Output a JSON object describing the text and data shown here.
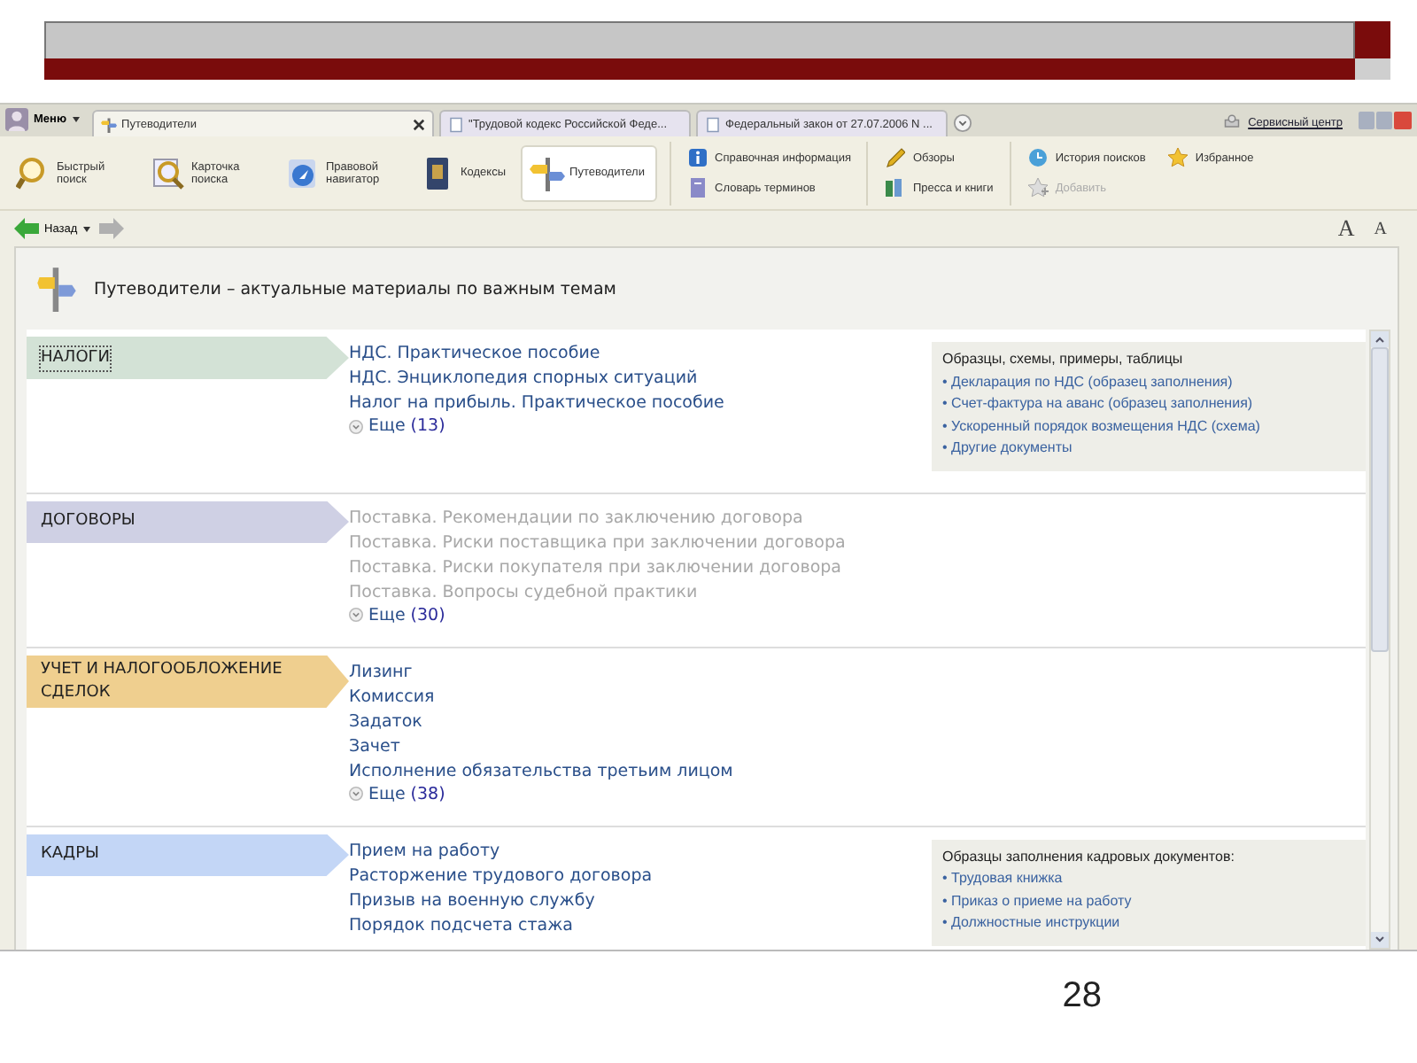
{
  "tab_bar": {
    "menu": "Меню",
    "tabs": [
      {
        "label": "Путеводители",
        "selected": true,
        "kind": "guide"
      },
      {
        "label": "\"Трудовой кодекс Российской Феде...",
        "selected": false,
        "kind": "doc"
      },
      {
        "label": "Федеральный закон от 27.07.2006 N ...",
        "selected": false,
        "kind": "doc"
      }
    ],
    "service_link": "Сервисный центр"
  },
  "toolbar": {
    "big_buttons": [
      {
        "label": "Быстрый поиск",
        "kind": "search",
        "selected": false
      },
      {
        "label": "Карточка поиска",
        "kind": "card",
        "selected": false
      },
      {
        "label": "Правовой навигатор",
        "kind": "compass",
        "selected": false
      },
      {
        "label": "Кодексы",
        "kind": "book",
        "selected": false
      },
      {
        "label": "Путеводители",
        "kind": "guide",
        "selected": true
      }
    ],
    "groups": [
      [
        {
          "label": "Справочная информация",
          "kind": "info",
          "disabled": false
        },
        {
          "label": "Словарь терминов",
          "kind": "dictionary",
          "disabled": false
        }
      ],
      [
        {
          "label": "Обзоры",
          "kind": "pen",
          "disabled": false
        },
        {
          "label": "Пресса и книги",
          "kind": "books",
          "disabled": false
        }
      ],
      [
        {
          "label": "История поисков",
          "kind": "clock",
          "disabled": false
        },
        {
          "label": "Избранное",
          "kind": "star",
          "disabled": false
        },
        {
          "label": "Добавить",
          "kind": "star-add",
          "disabled": true
        }
      ]
    ]
  },
  "nav": {
    "back": "Назад",
    "font_buttons": [
      {
        "label": "A",
        "kind": "increase"
      },
      {
        "label": "A",
        "kind": "decrease"
      }
    ]
  },
  "content": {
    "title": "Путеводители – актуальные материалы по важным темам",
    "sections": [
      {
        "label": "НАЛОГИ",
        "color": "#d3e2d6",
        "selected": true,
        "links": [
          {
            "text": "НДС. Практическое пособие",
            "visited": false
          },
          {
            "text": "НДС. Энциклопедия спорных ситуаций",
            "visited": false
          },
          {
            "text": "Налог на прибыль. Практическое пособие",
            "visited": false
          }
        ],
        "more": {
          "label": "Еще",
          "count": "(13)"
        },
        "side": {
          "heading": "Образцы, схемы, примеры, таблицы",
          "items": [
            "• Декларация по НДС (образец заполнения)",
            "• Счет-фактура на аванс (образец заполнения)",
            "• Ускоренный порядок возмещения НДС (схема)",
            "• Другие документы"
          ]
        }
      },
      {
        "label": "ДОГОВОРЫ",
        "color": "#cfd0e4",
        "selected": false,
        "links": [
          {
            "text": "Поставка. Рекомендации по заключению договора",
            "visited": true
          },
          {
            "text": "Поставка. Риски поставщика при заключении договора",
            "visited": true
          },
          {
            "text": "Поставка. Риски покупателя при заключении договора",
            "visited": true
          },
          {
            "text": "Поставка. Вопросы судебной практики",
            "visited": true
          }
        ],
        "more": {
          "label": "Еще",
          "count": "(30)"
        }
      },
      {
        "label": "УЧЕТ И НАЛОГООБЛОЖЕНИЕ СДЕЛОК",
        "color": "#efcf8f",
        "selected": false,
        "links": [
          {
            "text": "Лизинг",
            "visited": false
          },
          {
            "text": "Комиссия",
            "visited": false
          },
          {
            "text": "Задаток",
            "visited": false
          },
          {
            "text": "Зачет",
            "visited": false
          },
          {
            "text": "Исполнение обязательства третьим лицом",
            "visited": false
          }
        ],
        "more": {
          "label": "Еще",
          "count": "(38)"
        }
      },
      {
        "label": "КАДРЫ",
        "color": "#c3d6f6",
        "selected": false,
        "links": [
          {
            "text": "Прием на работу",
            "visited": false
          },
          {
            "text": "Расторжение трудового договора",
            "visited": false
          },
          {
            "text": "Призыв на военную службу",
            "visited": false
          },
          {
            "text": "Порядок подсчета стажа",
            "visited": false
          }
        ],
        "side": {
          "heading": "Образцы заполнения кадровых документов:",
          "items": [
            "• Трудовая книжка",
            "• Приказ о приеме на работу",
            "• Должностные инструкции"
          ]
        }
      }
    ]
  },
  "page_number": "28"
}
